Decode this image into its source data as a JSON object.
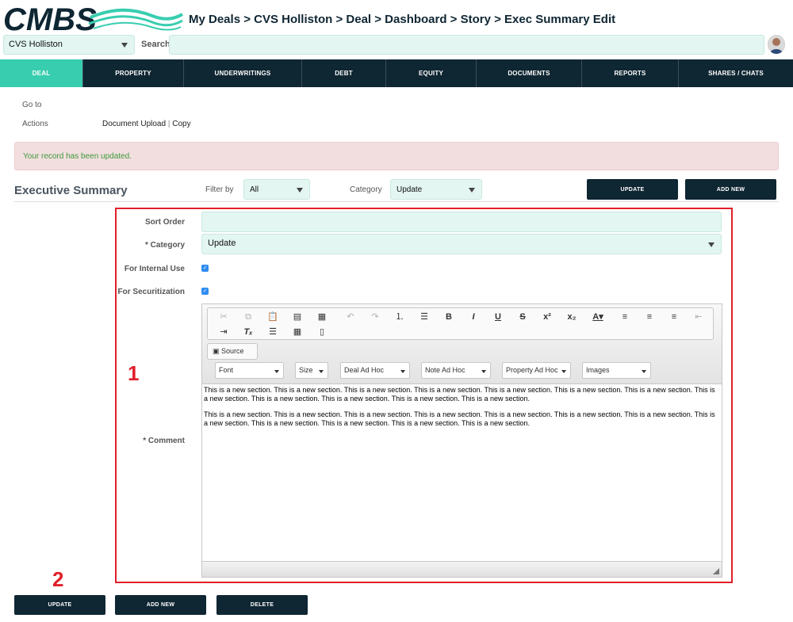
{
  "header": {
    "breadcrumb": "My Deals > CVS Holliston > Deal > Dashboard > Story > Exec Summary Edit",
    "deal_select": "CVS Holliston",
    "search_label": "Search",
    "search_value": "",
    "colors": {
      "brand_dark": "#0f2633",
      "accent": "#39cdb0",
      "field_bg": "#e3f6f1"
    }
  },
  "nav": {
    "items": [
      "DEAL",
      "PROPERTY",
      "UNDERWRITINGS",
      "DEBT",
      "EQUITY",
      "DOCUMENTS",
      "REPORTS",
      "SHARES / CHATS"
    ],
    "active": "DEAL"
  },
  "info": {
    "goto_label": "Go to",
    "actions_label": "Actions",
    "actions_links": [
      "Document Upload",
      "Copy"
    ],
    "separator": "|"
  },
  "alert": {
    "message": "Your record has been updated."
  },
  "section": {
    "title": "Executive Summary",
    "filter_label": "Filter by",
    "filter_value": "All",
    "category_label": "Category",
    "category_value": "Update",
    "update_btn": "UPDATE",
    "add_new_btn": "ADD NEW"
  },
  "form": {
    "sort_order_label": "Sort Order",
    "sort_order_value": "",
    "category_label": "* Category",
    "category_value": "Update",
    "internal_label": "For Internal Use",
    "internal_checked": true,
    "securitization_label": "For Securitization",
    "securitization_checked": true,
    "comment_label": "* Comment"
  },
  "editor": {
    "source_label": "Source",
    "combos": [
      "Font",
      "Size",
      "Deal Ad Hoc",
      "Note Ad Hoc",
      "Property Ad Hoc",
      "Images"
    ],
    "paragraphs": [
      "This is a new section. This is a new section. This is a new section. This is a new section. This is a new section. This is a new section. This is a new section. This is a new section. This is a new section. This is a new section. This is a new section. This is a new section.",
      "This is a new section. This is a new section. This is a new section. This is a new section. This is a new section. This is a new section. This is a new section. This is a new section. This is a new section. This is a new section. This is a new section. This is a new section."
    ],
    "toolbar_icons": [
      "cut-icon",
      "copy-icon",
      "paste-icon",
      "paste-text-icon",
      "paste-word-icon",
      "undo-icon",
      "redo-icon",
      "numbered-list-icon",
      "bulleted-list-icon",
      "bold-icon",
      "italic-icon",
      "underline-icon",
      "strike-icon",
      "superscript-icon",
      "subscript-icon",
      "text-color-icon",
      "align-left-icon",
      "align-center-icon",
      "align-right-icon",
      "outdent-icon",
      "indent-icon",
      "remove-format-icon",
      "horizontal-rule-icon",
      "table-icon",
      "page-break-icon"
    ]
  },
  "footer": {
    "update_btn": "UPDATE",
    "add_new_btn": "ADD NEW",
    "delete_btn": "DELETE"
  },
  "annotations": {
    "one": "1",
    "two": "2"
  }
}
